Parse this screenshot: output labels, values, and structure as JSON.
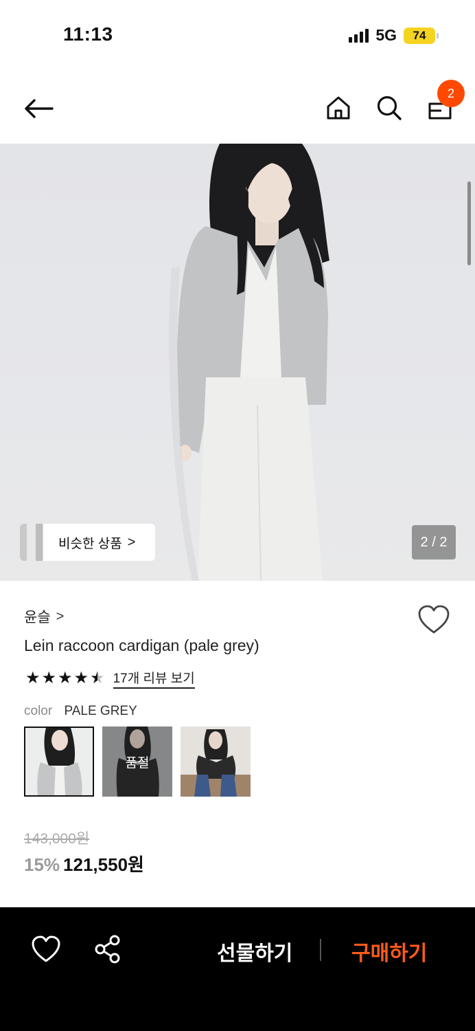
{
  "status": {
    "time": "11:13",
    "network": "5G",
    "battery": "74"
  },
  "nav": {
    "cart_count": "2"
  },
  "hero": {
    "similar_label": "비슷한 상품",
    "similar_chevron": ">",
    "page_indicator": "2 / 2"
  },
  "product": {
    "brand": "윤슬",
    "brand_chevron": ">",
    "name": "Lein raccoon cardigan (pale grey)",
    "rating": 4.5,
    "review_link": "17개 리뷰 보기",
    "color_label": "color",
    "color_value": "PALE GREY",
    "swatches": [
      {
        "name": "pale grey",
        "selected": true
      },
      {
        "name": "charcoal",
        "soldout_label": "품절"
      },
      {
        "name": "black"
      }
    ],
    "original_price": "143,000원",
    "discount": "15%",
    "sale_price": "121,550원"
  },
  "bottom": {
    "gift_label": "선물하기",
    "buy_label": "구매하기"
  },
  "colors": {
    "accent": "#ff4800",
    "buy": "#ff5a1a",
    "bar": "#000000"
  },
  "icons": [
    "back-arrow-icon",
    "home-icon",
    "search-icon",
    "cart-icon",
    "heart-icon",
    "share-icon",
    "star-icon",
    "chevron-right-icon"
  ]
}
